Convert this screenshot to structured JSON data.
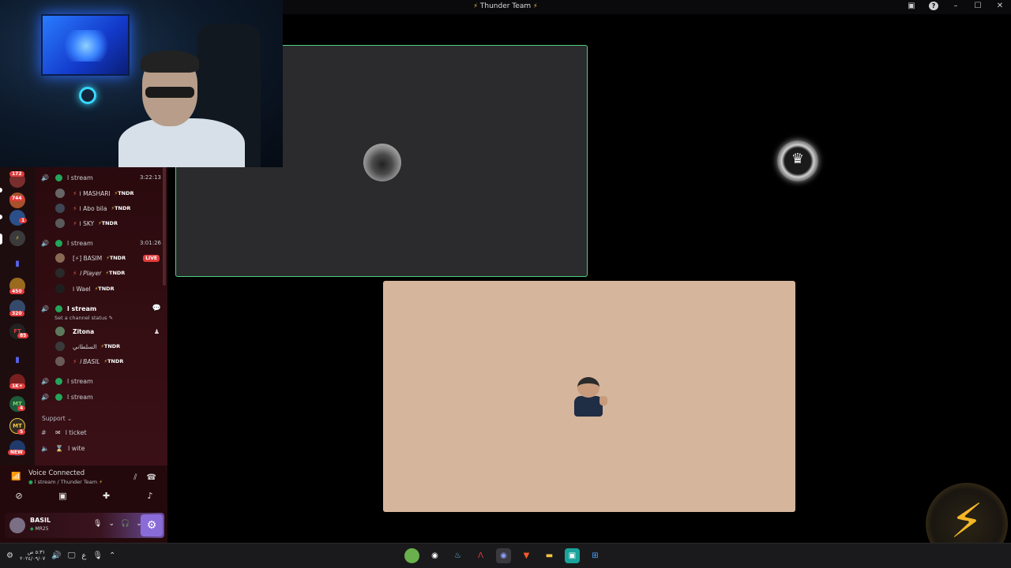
{
  "window": {
    "title": "Thunder Team",
    "title_icon_left": "thunder-icon",
    "title_icon_right": "bolt-icon"
  },
  "rail": {
    "servers": [
      {
        "badge": "172",
        "color": "#7a2d2d"
      },
      {
        "badge": "744",
        "color": "#a8512a"
      },
      {
        "badge": "1",
        "color": "#2b4f88"
      },
      {
        "badge": "",
        "color": "#3b3b3b"
      },
      {
        "badge": "",
        "color": "#5865f2"
      },
      {
        "badge": "450",
        "color": "#9a6b1f"
      },
      {
        "badge": "320",
        "color": "#354a6b"
      },
      {
        "badge": "85",
        "color": "#222",
        "text": "FT"
      },
      {
        "badge": "",
        "color": "#5865f2"
      },
      {
        "badge": "1K+",
        "color": "#7a1f1f"
      },
      {
        "badge": "4",
        "color": "#1f5a3a",
        "text": "MT"
      },
      {
        "badge": "5",
        "color": "#2f2a22",
        "text": "MT"
      },
      {
        "badge": "NEW",
        "color": "#1f3a6b"
      }
    ]
  },
  "channels": {
    "groups": [
      {
        "name": "ا stream",
        "timer": "3:22:13",
        "members": [
          {
            "name": "ا MASHARI",
            "tag": "TNDR"
          },
          {
            "name": "ا Abo bila",
            "tag": "TNDR"
          },
          {
            "name": "ا SKY",
            "tag": "TNDR"
          }
        ]
      },
      {
        "name": "ا stream",
        "timer": "3:01:26",
        "members": [
          {
            "name": "[⚡] BASIM",
            "tag": "TNDR",
            "live": "LIVE"
          },
          {
            "name": "ا Player",
            "tag": "TNDR"
          },
          {
            "name": "ا Wael",
            "tag": "TNDR"
          }
        ]
      },
      {
        "name": "ا stream",
        "status": "Set a channel status",
        "members": [
          {
            "name": "Zitona",
            "tag": ""
          },
          {
            "name": "السلطاني",
            "tag": "TNDR"
          },
          {
            "name": "ا BASIL",
            "tag": "TNDR"
          }
        ]
      }
    ],
    "extra_voice": [
      "ا stream",
      "ا stream"
    ],
    "section": "Support",
    "support": [
      {
        "icon": "hash",
        "name": "ا ticket"
      },
      {
        "icon": "speaker",
        "name": "ا wite"
      }
    ]
  },
  "voice": {
    "title": "Voice Connected",
    "subtitle": "ا stream / Thunder Team",
    "user_name": "BASIL",
    "user_sub": "MR25"
  },
  "tiles": [
    {
      "border": "#4fd07e"
    },
    {},
    {
      "bg": "#d5b59c"
    }
  ],
  "taskbar": {
    "clock_time": "٥:٣١ ص",
    "clock_date": "٢٠٢٤/٠٩/٠٧",
    "lang": "ع",
    "apps": [
      "app-icon",
      "obs-icon",
      "steam-icon",
      "game-icon",
      "discord-icon",
      "brave-icon",
      "folder-icon",
      "app-icon-2",
      "windows-icon"
    ]
  }
}
